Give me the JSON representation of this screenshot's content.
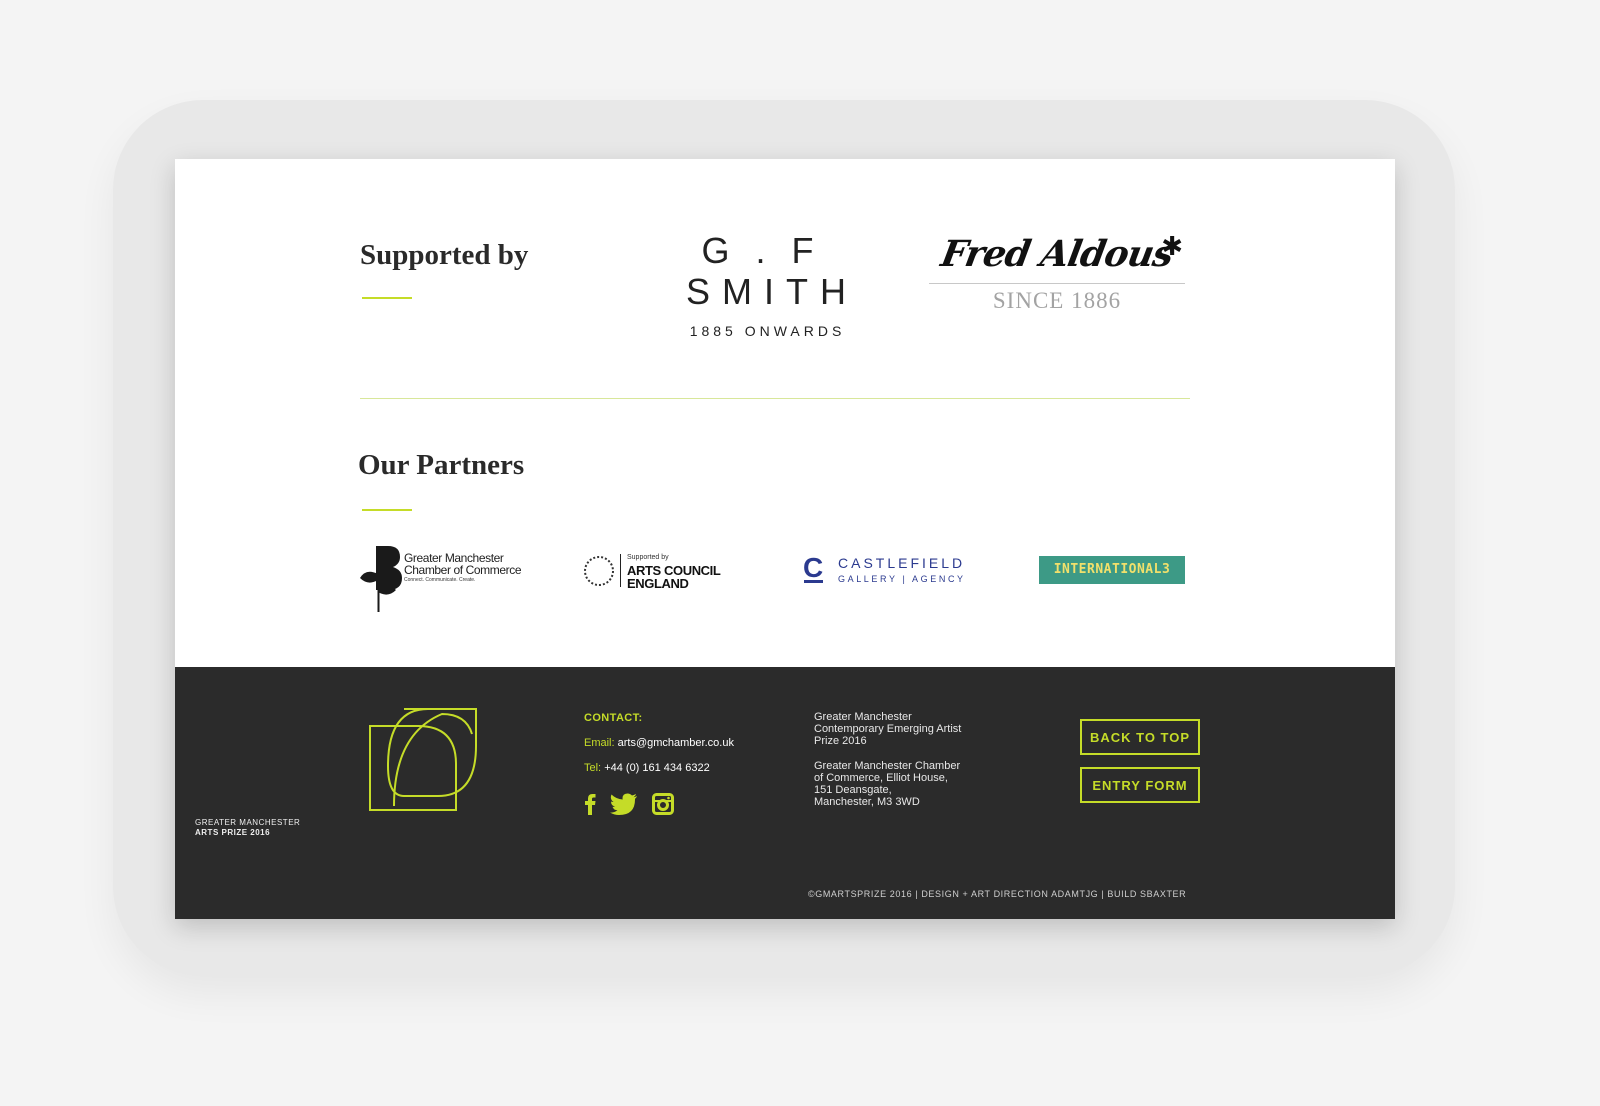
{
  "supported": {
    "heading": "Supported by",
    "gfsmith": {
      "line1": "G.F",
      "line2": "SMITH",
      "line3": "1885 ONWARDS"
    },
    "fred_aldous": {
      "script": "Fred Aldous",
      "since": "SINCE 1886"
    }
  },
  "partners": {
    "heading": "Our Partners",
    "gmcc": {
      "name_line1": "Greater Manchester",
      "name_line2": "Chamber of Commerce",
      "tagline": "Connect. Communicate. Create."
    },
    "ace": {
      "small": "Supported by",
      "big_line1": "ARTS COUNCIL",
      "big_line2": "ENGLAND"
    },
    "castlefield": {
      "mark": "C",
      "name": "CASTLEFIELD",
      "sub": "GALLERY | AGENCY"
    },
    "international": {
      "text": "INTERNATIONAL3"
    }
  },
  "footer": {
    "logo_caption_line1": "GREATER MANCHESTER",
    "logo_caption_line2": "ARTS PRIZE 2016",
    "contact": {
      "label": "CONTACT:",
      "email_key": "Email:",
      "email_value": "arts@gmchamber.co.uk",
      "tel_key": "Tel:",
      "tel_value": "+44 (0) 161 434 6322"
    },
    "address": {
      "prize_line1": "Greater Manchester",
      "prize_line2": "Contemporary Emerging Artist",
      "prize_line3": "Prize 2016",
      "addr_line1": "Greater Manchester Chamber",
      "addr_line2": "of Commerce, Elliot House,",
      "addr_line3": "151 Deansgate,",
      "addr_line4": "Manchester, M3 3WD"
    },
    "back_to_top": "BACK TO TOP",
    "entry_form": "ENTRY FORM",
    "copyright": "©GMARTSPRIZE 2016 | DESIGN + ART DIRECTION ADAMTJG | BUILD SBAXTER"
  },
  "colors": {
    "accent": "#c5dc28",
    "footer_bg": "#2b2b2b",
    "castlefield_blue": "#2b3a8f"
  }
}
